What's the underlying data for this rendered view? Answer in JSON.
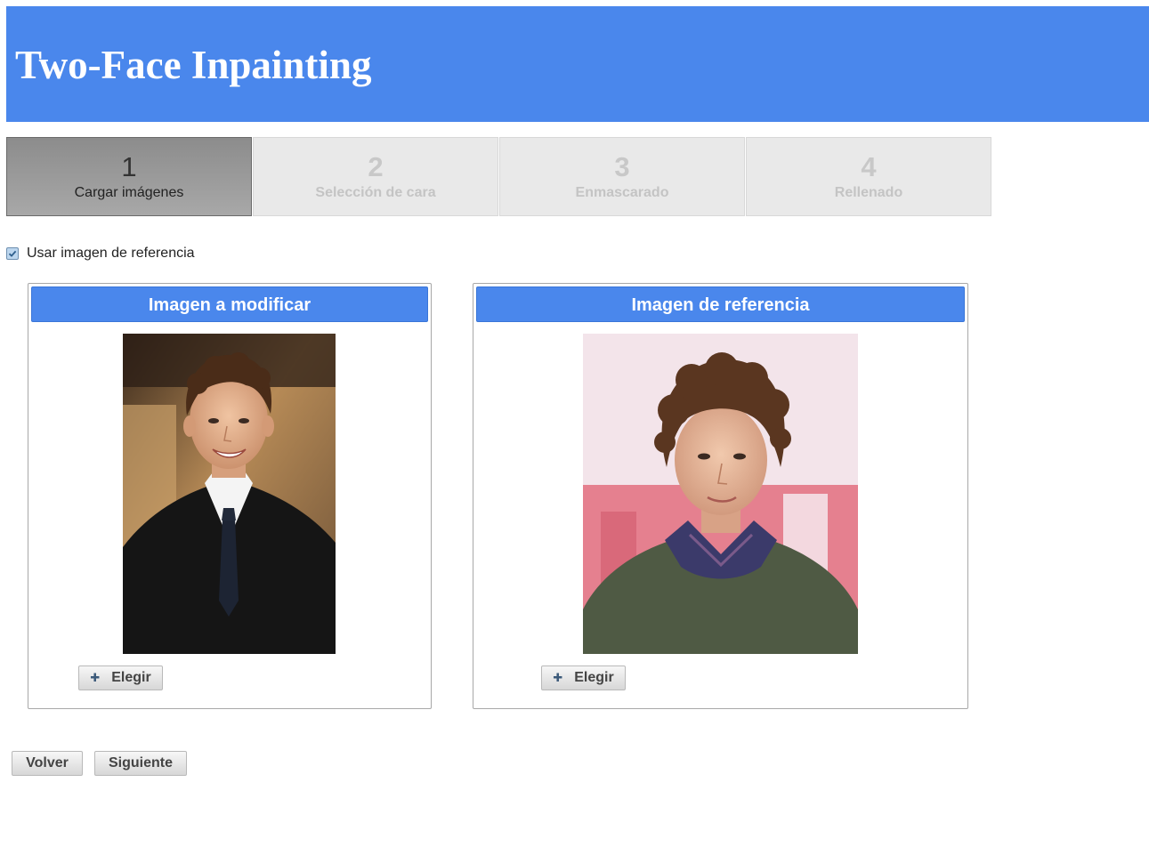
{
  "app": {
    "title": "Two-Face Inpainting"
  },
  "steps": [
    {
      "number": "1",
      "label": "Cargar imágenes",
      "active": true
    },
    {
      "number": "2",
      "label": "Selección de cara",
      "active": false
    },
    {
      "number": "3",
      "label": "Enmascarado",
      "active": false
    },
    {
      "number": "4",
      "label": "Rellenado",
      "active": false
    }
  ],
  "reference_toggle": {
    "label": "Usar imagen de referencia",
    "checked": true
  },
  "panels": {
    "target": {
      "title": "Imagen a modificar",
      "choose_label": "Elegir"
    },
    "reference": {
      "title": "Imagen de referencia",
      "choose_label": "Elegir"
    }
  },
  "footer": {
    "back_label": "Volver",
    "next_label": "Siguiente"
  },
  "colors": {
    "accent": "#4a87ec",
    "header_text": "#ffffff"
  }
}
